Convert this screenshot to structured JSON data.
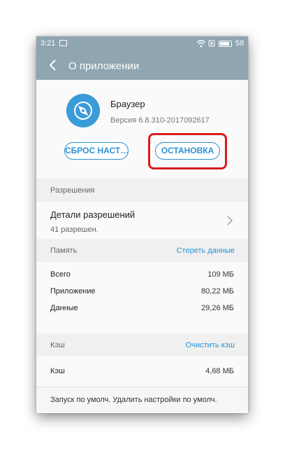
{
  "status_bar": {
    "time": "3:21",
    "battery": "58"
  },
  "header": {
    "title": "О приложении"
  },
  "app": {
    "name": "Браузер",
    "version": "Версия 6.8.310-2017092617",
    "reset_button": "СБРОС НАСТ…",
    "stop_button": "ОСТАНОВКА"
  },
  "permissions": {
    "section_label": "Разрешения",
    "details_title": "Детали разрешений",
    "details_count": "41 разрешен."
  },
  "memory": {
    "section_label": "Память",
    "action": "Стереть данные",
    "rows": [
      {
        "label": "Всего",
        "value": "109 МБ"
      },
      {
        "label": "Приложение",
        "value": "80,22 МБ"
      },
      {
        "label": "Данные",
        "value": "29,26 МБ"
      }
    ]
  },
  "cache": {
    "section_label": "Кэш",
    "action": "Очистить кэш",
    "row": {
      "label": "Кэш",
      "value": "4,68 МБ"
    }
  },
  "defaults": {
    "text": "Запуск по умолч.  Удалить настройки по умолч."
  },
  "colors": {
    "accent": "#2b92d4",
    "topbar": "#8fa5b1",
    "highlight": "#d81d1d",
    "app_icon": "#3a9bd9"
  }
}
